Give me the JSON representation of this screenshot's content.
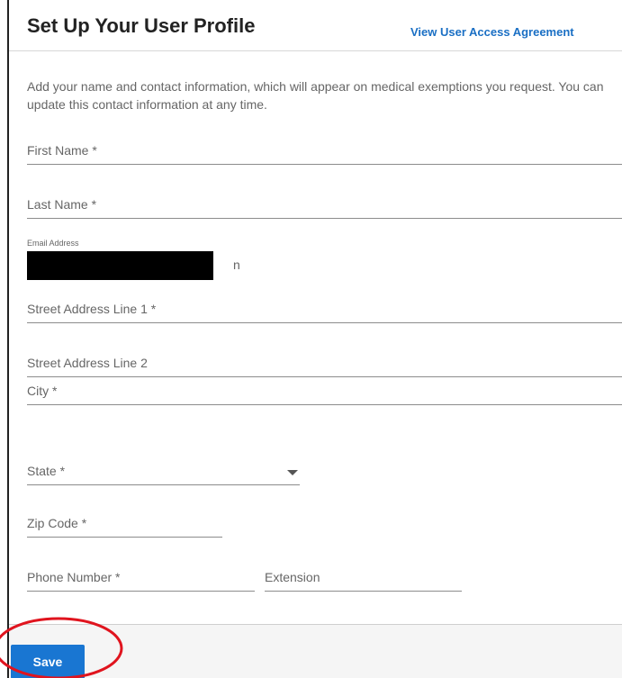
{
  "header": {
    "title": "Set Up Your User Profile",
    "agreement_link": "View User Access Agreement"
  },
  "intro_text": "Add your name and contact information, which will appear on medical exemptions you request. You can update this contact information at any time.",
  "form": {
    "first_name_label": "First Name *",
    "last_name_label": "Last Name *",
    "email_label": "Email Address",
    "email_visible_tail": "n",
    "street1_label": "Street Address Line 1 *",
    "street2_label": "Street Address Line 2",
    "city_label": "City *",
    "state_label": "State *",
    "zip_label": "Zip Code *",
    "phone_label": "Phone Number *",
    "extension_label": "Extension"
  },
  "footer": {
    "save_label": "Save"
  },
  "annotation": {
    "ellipse_color": "#e0141e"
  },
  "colors": {
    "link": "#1a6fc4",
    "primary_button": "#1976d2"
  }
}
